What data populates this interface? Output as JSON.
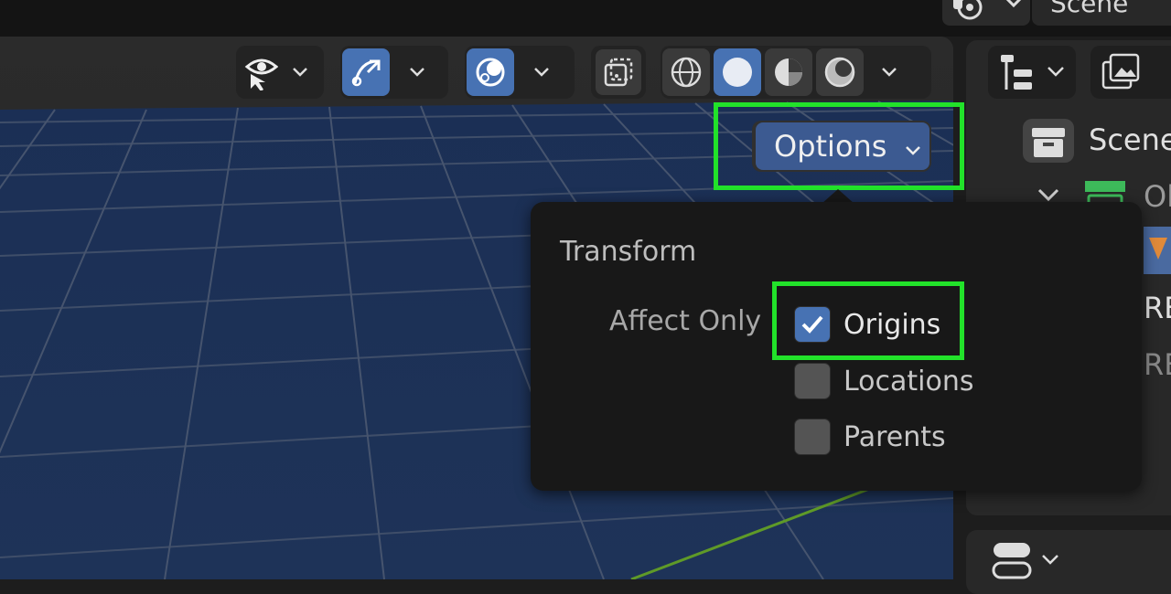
{
  "topbar": {
    "scene_field": "Scene",
    "scene_icon": "scene-data-icon"
  },
  "viewport_header": {
    "visibility_icon": "visibility-eye-icon",
    "gizmo_icon": "gizmo-icon",
    "overlay_icon": "overlay-icon",
    "xray_icon": "xray-toggle-icon",
    "shading_modes": [
      "wireframe",
      "solid",
      "material-preview",
      "rendered"
    ],
    "shading_active": "solid"
  },
  "options_button": {
    "label": "Options"
  },
  "options_popup": {
    "section_title": "Transform",
    "affect_only_label": "Affect Only",
    "checkboxes": [
      {
        "label": "Origins",
        "checked": true
      },
      {
        "label": "Locations",
        "checked": false
      },
      {
        "label": "Parents",
        "checked": false
      }
    ]
  },
  "outliner": {
    "scene_label": "Scene",
    "row_partial_1": "Ol",
    "row_partial_2": "RE",
    "row_partial_3": "RE"
  },
  "colors": {
    "accent": "#4772b3",
    "highlight": "#22e22a",
    "popup_bg": "#181818"
  }
}
